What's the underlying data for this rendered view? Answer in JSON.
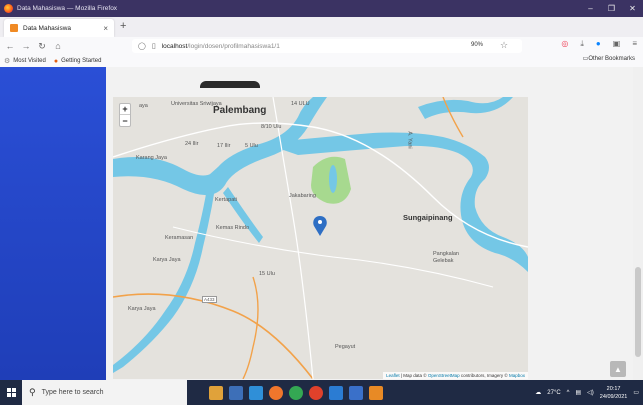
{
  "window": {
    "title": "Data Mahasiswa — Mozilla Firefox"
  },
  "tabs": [
    {
      "label": "Data Mahasiswa"
    }
  ],
  "nav": {
    "url_host": "localhost",
    "url_path": "/login/dosen/profilmahasiswa1/1",
    "zoom": "90%"
  },
  "bookmarks": {
    "items": [
      "Most Visited",
      "Getting Started"
    ],
    "other": "Other Bookmarks"
  },
  "map": {
    "labels": {
      "palembang": "Palembang",
      "ulu14": "14 ULU",
      "ulu810": "8/10 Ulu",
      "ulu5": "5 Ulu",
      "ilir24": "24 Ilir",
      "ilir17": "17 Ilir",
      "karangjaya": "Karang Jaya",
      "universitas": "Universitas Sriwijaya",
      "kertapati": "Kertapati",
      "jakabaring": "Jakabaring",
      "sungaipinang": "Sungaipinang",
      "keramasan": "Keramasan",
      "kemasrindo": "Kemas Rindo",
      "karyajaya": "Karya Jaya",
      "ulu15": "15 Ulu",
      "pangkalan": "Pangkalan\nGelebak",
      "karyajaya2": "Karya Jaya",
      "pegayut": "Pegayut",
      "aya": "aya",
      "road": "A. Yani",
      "shield": "A433"
    },
    "zoom_in": "+",
    "zoom_out": "−",
    "attribution": {
      "leaflet": "Leaflet",
      "mid": " | Map data © ",
      "osm": "OpenStreetMap",
      "contrib": " contributors, Imagery © ",
      "mapbox": "Mapbox"
    }
  },
  "taskbar": {
    "search_placeholder": "Type here to search",
    "weather": "27°C",
    "time": "20:17",
    "date": "24/09/2021"
  },
  "colors": {
    "sidebar": "#2446c9",
    "water": "#74c7e6",
    "park": "#a7d98f",
    "marker": "#2e6fc4",
    "road_orange": "#f2a24a"
  }
}
